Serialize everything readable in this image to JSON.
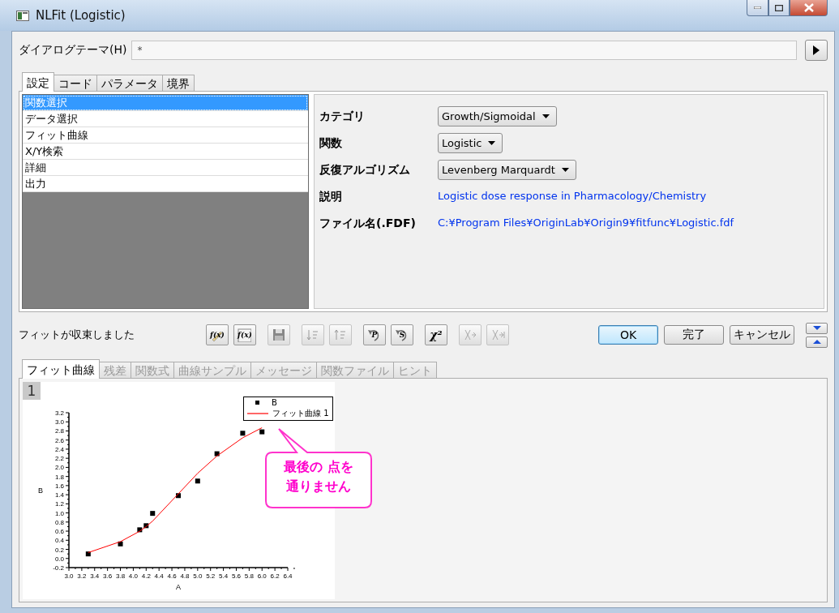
{
  "window": {
    "title": "NLFit (Logistic)"
  },
  "theme": {
    "label": "ダイアログテーマ(H)",
    "value": "*"
  },
  "tabs": [
    {
      "label": "設定",
      "selected": true
    },
    {
      "label": "コード",
      "selected": false
    },
    {
      "label": "パラメータ",
      "selected": false
    },
    {
      "label": "境界",
      "selected": false
    }
  ],
  "sidebar": {
    "items": [
      {
        "label": "関数選択",
        "selected": true
      },
      {
        "label": "データ選択",
        "selected": false
      },
      {
        "label": "フィット曲線",
        "selected": false
      },
      {
        "label": "X/Y検索",
        "selected": false
      },
      {
        "label": "詳細",
        "selected": false
      },
      {
        "label": "出力",
        "selected": false
      }
    ]
  },
  "settings": [
    {
      "kind": "dropdown",
      "label": "カテゴリ",
      "value": "Growth/Sigmoidal"
    },
    {
      "kind": "dropdown",
      "label": "関数",
      "value": "Logistic"
    },
    {
      "kind": "dropdown",
      "label": "反復アルゴリズム",
      "value": "Levenberg Marquardt"
    },
    {
      "kind": "info",
      "label": "説明",
      "value": "Logistic dose response in Pharmacology/Chemistry"
    },
    {
      "kind": "info",
      "label": "ファイル名(.FDF)",
      "value": "C:¥Program Files¥OriginLab¥Origin9¥fitfunc¥Logistic.fdf"
    }
  ],
  "status": "フィットが収束しました",
  "toolbar": [
    {
      "kind": "fx-edit",
      "label": "f(x)",
      "disabled": false
    },
    {
      "kind": "fx-file",
      "label": "f(x)",
      "disabled": false
    },
    {
      "kind": "save",
      "disabled": true
    },
    {
      "kind": "sort-down",
      "disabled": true
    },
    {
      "kind": "sort-up",
      "disabled": true
    },
    {
      "kind": "undo-p",
      "label": "P",
      "disabled": false
    },
    {
      "kind": "undo-s",
      "label": "S",
      "disabled": false
    },
    {
      "kind": "chi-square",
      "label": "χ²",
      "disabled": false
    },
    {
      "kind": "iterate-one",
      "disabled": true
    },
    {
      "kind": "iterate-all",
      "disabled": true
    }
  ],
  "buttons": [
    {
      "label": "OK",
      "default": true
    },
    {
      "label": "完了",
      "default": false
    },
    {
      "label": "キャンセル",
      "default": false
    }
  ],
  "result_tabs": [
    {
      "label": "フィット曲線",
      "selected": true,
      "disabled": false
    },
    {
      "label": "残差",
      "selected": false,
      "disabled": true
    },
    {
      "label": "関数式",
      "selected": false,
      "disabled": true
    },
    {
      "label": "曲線サンプル",
      "selected": false,
      "disabled": true
    },
    {
      "label": "メッセージ",
      "selected": false,
      "disabled": true
    },
    {
      "label": "関数ファイル",
      "selected": false,
      "disabled": true
    },
    {
      "label": "ヒント",
      "selected": false,
      "disabled": true
    }
  ],
  "graph": {
    "layer": "1",
    "chart_data": {
      "type": "scatter",
      "xlabel": "A",
      "ylabel": "B",
      "x": [
        3.3,
        3.8,
        4.1,
        4.2,
        4.3,
        4.7,
        5.0,
        5.3,
        5.7,
        6.0
      ],
      "series": [
        {
          "name": "B",
          "color": "#000000",
          "type": "scatter",
          "values": [
            0.1,
            0.32,
            0.63,
            0.72,
            0.99,
            1.38,
            1.7,
            2.3,
            2.75,
            2.78
          ]
        },
        {
          "name": "フィット曲線 1",
          "color": "#ff0000",
          "type": "line",
          "values": [
            0.13,
            0.37,
            0.6,
            0.7,
            0.82,
            1.42,
            1.87,
            2.25,
            2.65,
            2.87
          ]
        }
      ],
      "xlim": [
        3.0,
        6.4
      ],
      "ylim": [
        -0.2,
        3.2
      ],
      "xticks": [
        {
          "value": 3.0,
          "label": "3.0"
        },
        {
          "value": 3.2,
          "label": "3.2"
        },
        {
          "value": 3.4,
          "label": "3.4"
        },
        {
          "value": 3.6,
          "label": "3.6"
        },
        {
          "value": 3.8,
          "label": "3.8"
        },
        {
          "value": 4.0,
          "label": "4.0"
        },
        {
          "value": 4.2,
          "label": "4.2"
        },
        {
          "value": 4.4,
          "label": "4.4"
        },
        {
          "value": 4.6,
          "label": "4.6"
        },
        {
          "value": 4.8,
          "label": "4.8"
        },
        {
          "value": 5.0,
          "label": "5.0"
        },
        {
          "value": 5.2,
          "label": "5.2"
        },
        {
          "value": 5.4,
          "label": "5.4"
        },
        {
          "value": 5.6,
          "label": "5.6"
        },
        {
          "value": 5.8,
          "label": "5.8"
        },
        {
          "value": 6.0,
          "label": "6.0"
        },
        {
          "value": 6.2,
          "label": "6.2"
        },
        {
          "value": 6.4,
          "label": "6.4"
        }
      ],
      "yticks": [
        {
          "value": -0.2,
          "label": "-0.2"
        },
        {
          "value": 0.0,
          "label": "0.0"
        },
        {
          "value": 0.2,
          "label": "0.2"
        },
        {
          "value": 0.4,
          "label": "0.4"
        },
        {
          "value": 0.6,
          "label": "0.6"
        },
        {
          "value": 0.8,
          "label": "0.8"
        },
        {
          "value": 1.0,
          "label": "1.0"
        },
        {
          "value": 1.2,
          "label": "1.2"
        },
        {
          "value": 1.4,
          "label": "1.4"
        },
        {
          "value": 1.6,
          "label": "1.6"
        },
        {
          "value": 1.8,
          "label": "1.8"
        },
        {
          "value": 2.0,
          "label": "2.0"
        },
        {
          "value": 2.2,
          "label": "2.2"
        },
        {
          "value": 2.4,
          "label": "2.4"
        },
        {
          "value": 2.6,
          "label": "2.6"
        },
        {
          "value": 2.8,
          "label": "2.8"
        },
        {
          "value": 3.0,
          "label": "3.0"
        },
        {
          "value": 3.2,
          "label": "3.2"
        }
      ],
      "annotations": [
        {
          "text": "最後の 点を通りません"
        }
      ]
    }
  }
}
